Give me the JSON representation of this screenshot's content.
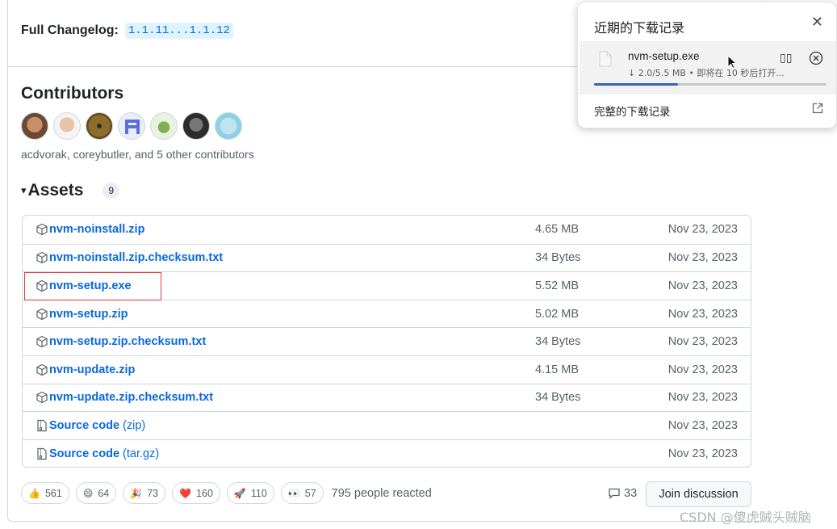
{
  "changelog": {
    "label": "Full Changelog:",
    "link": "1.1.11...1.1.12"
  },
  "contributors": {
    "title": "Contributors",
    "summary": "acdvorak, coreybutler, and 5 other contributors"
  },
  "assets": {
    "title": "Assets",
    "count": "9",
    "rows": [
      {
        "name": "nvm-noinstall.zip",
        "ext": "",
        "size": "4.65 MB",
        "date": "Nov 23, 2023",
        "icon": "package-icon"
      },
      {
        "name": "nvm-noinstall.zip.checksum.txt",
        "ext": "",
        "size": "34 Bytes",
        "date": "Nov 23, 2023",
        "icon": "package-icon"
      },
      {
        "name": "nvm-setup.exe",
        "ext": "",
        "size": "5.52 MB",
        "date": "Nov 23, 2023",
        "icon": "package-icon"
      },
      {
        "name": "nvm-setup.zip",
        "ext": "",
        "size": "5.02 MB",
        "date": "Nov 23, 2023",
        "icon": "package-icon"
      },
      {
        "name": "nvm-setup.zip.checksum.txt",
        "ext": "",
        "size": "34 Bytes",
        "date": "Nov 23, 2023",
        "icon": "package-icon"
      },
      {
        "name": "nvm-update.zip",
        "ext": "",
        "size": "4.15 MB",
        "date": "Nov 23, 2023",
        "icon": "package-icon"
      },
      {
        "name": "nvm-update.zip.checksum.txt",
        "ext": "",
        "size": "34 Bytes",
        "date": "Nov 23, 2023",
        "icon": "package-icon"
      },
      {
        "name": "Source code",
        "ext": "(zip)",
        "size": "",
        "date": "Nov 23, 2023",
        "icon": "file-zip-icon"
      },
      {
        "name": "Source code",
        "ext": "(tar.gz)",
        "size": "",
        "date": "Nov 23, 2023",
        "icon": "file-zip-icon"
      }
    ]
  },
  "reactions": {
    "items": [
      {
        "emoji": "👍",
        "count": "561",
        "name": "thumbs-up"
      },
      {
        "emoji": "😄",
        "count": "64",
        "name": "smile"
      },
      {
        "emoji": "🎉",
        "count": "73",
        "name": "tada"
      },
      {
        "emoji": "❤️",
        "count": "160",
        "name": "heart"
      },
      {
        "emoji": "🚀",
        "count": "110",
        "name": "rocket"
      },
      {
        "emoji": "👀",
        "count": "57",
        "name": "eyes"
      }
    ],
    "summary": "795 people reacted"
  },
  "discussion": {
    "comment_count": "33",
    "join_label": "Join discussion"
  },
  "downloads": {
    "title": "近期的下载记录",
    "file_name": "nvm-setup.exe",
    "status": "↓ 2.0/5.5 MB • 即将在 10 秒后打开...",
    "progress_fraction": 0.36,
    "full_history": "完整的下载记录",
    "close_glyph": "✕",
    "pause_glyph": "▯▯"
  },
  "watermark": "CSDN @傻虎贼头贼脑",
  "colors": {
    "link": "#0969da",
    "highlight": "#e0383e",
    "progress": "#3c60b8"
  }
}
